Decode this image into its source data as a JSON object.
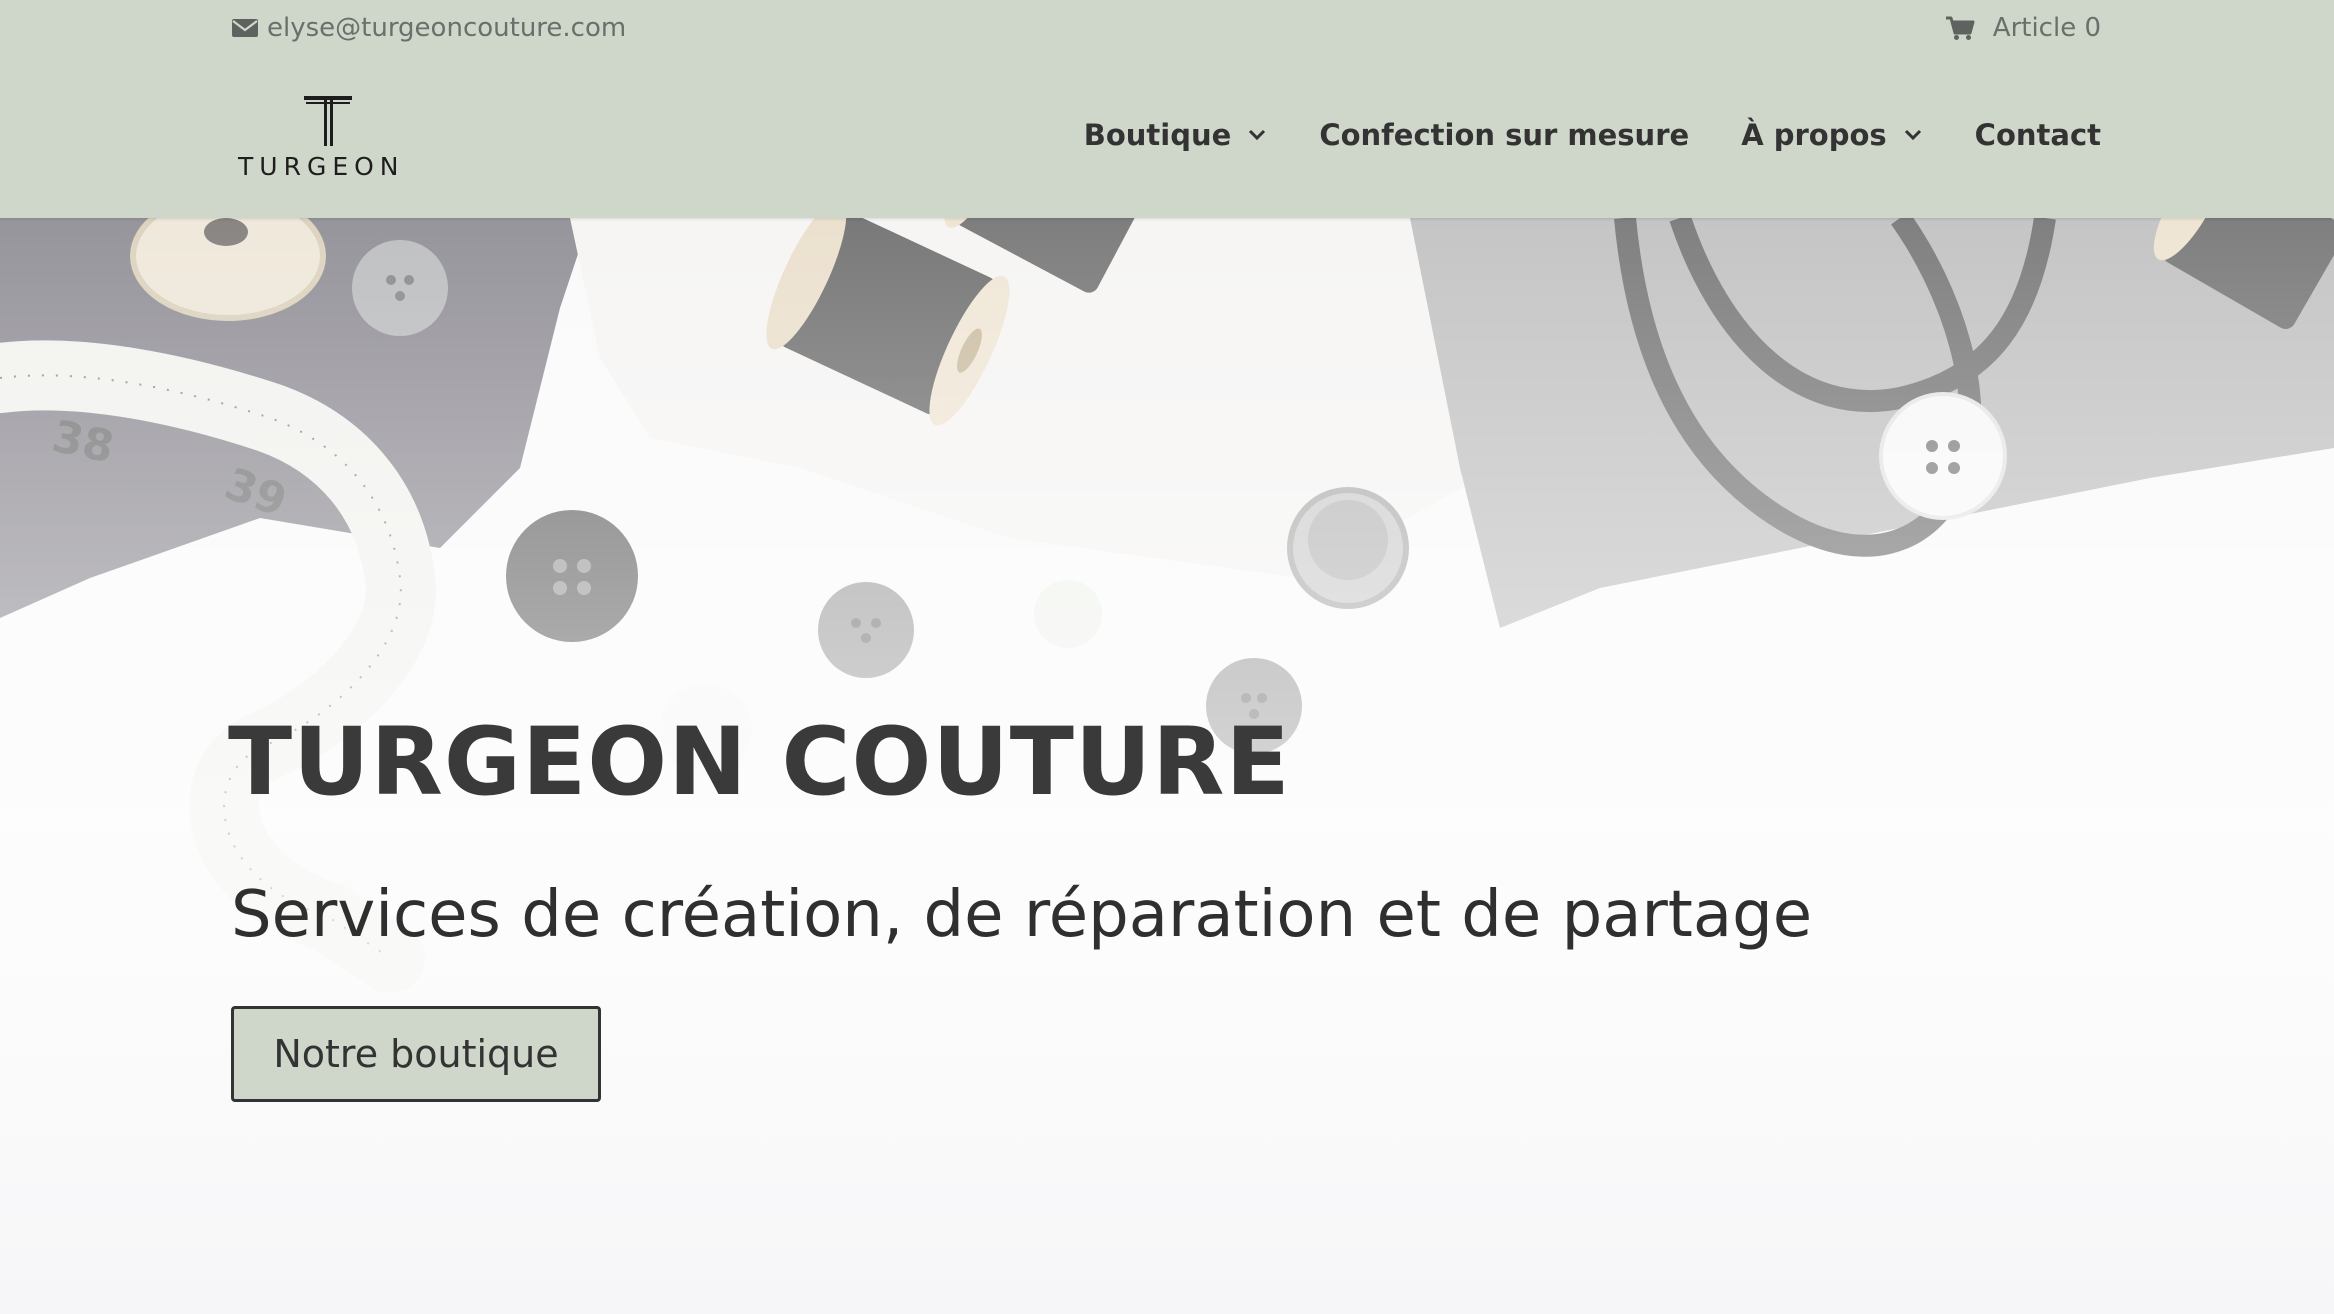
{
  "topbar": {
    "email": "elyse@turgeoncouture.com",
    "email_icon": "envelope-icon",
    "cart_label": "Article 0",
    "cart_icon": "shopping-cart-icon"
  },
  "logo": {
    "wordmark": "TURGEON"
  },
  "nav": {
    "items": [
      {
        "label": "Boutique",
        "has_dropdown": true
      },
      {
        "label": "Confection sur mesure",
        "has_dropdown": false
      },
      {
        "label": "À propos",
        "has_dropdown": true
      },
      {
        "label": "Contact",
        "has_dropdown": false
      }
    ]
  },
  "hero": {
    "title": "TURGEON COUTURE",
    "subtitle": "Services de création, de réparation et de partage",
    "button_label": "Notre boutique"
  },
  "colors": {
    "header_bg": "#cfd7cb",
    "text_dark": "#333333",
    "text_muted": "#6b6f6b",
    "button_bg": "#cfd7cb"
  }
}
